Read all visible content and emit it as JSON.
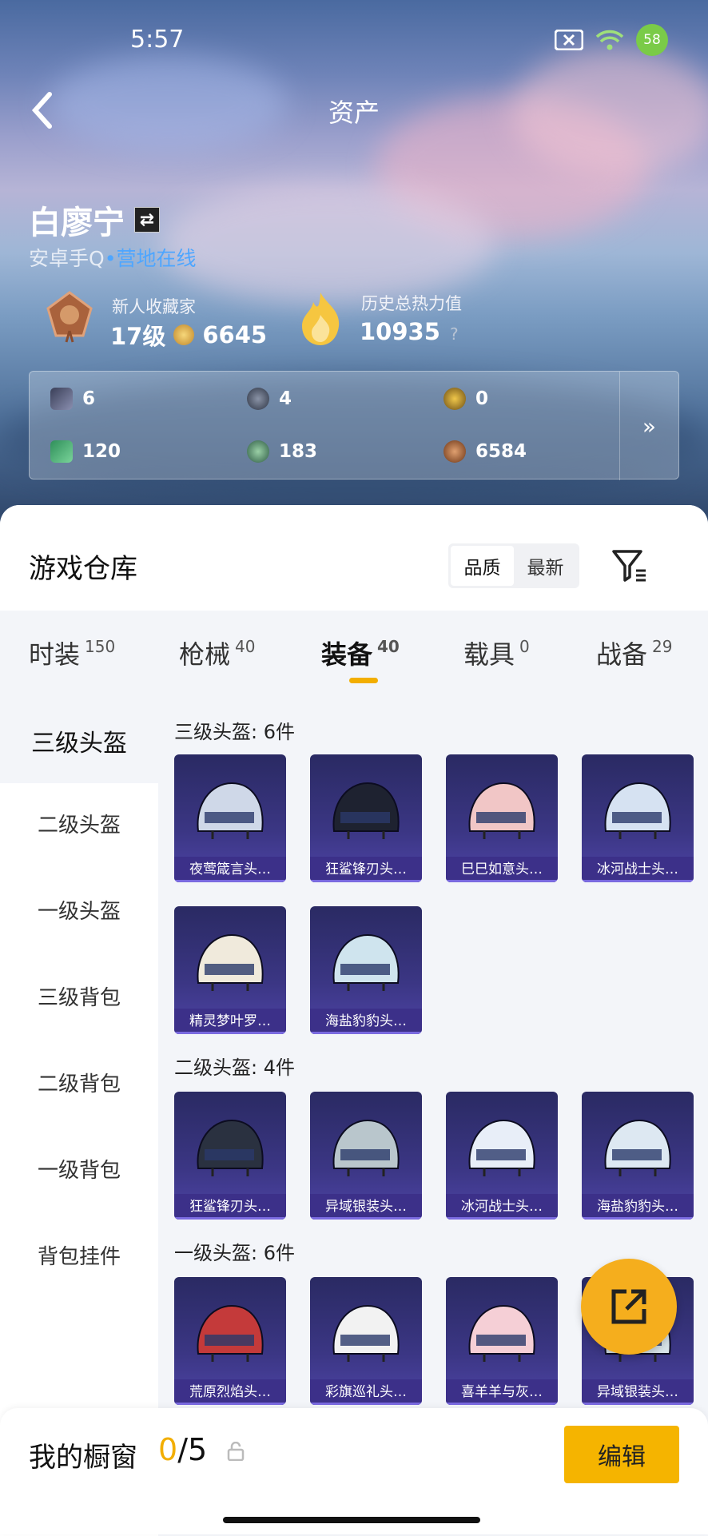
{
  "status": {
    "time": "5:57",
    "battery": "58"
  },
  "header": {
    "title": "资产"
  },
  "user": {
    "name": "白廖宁",
    "platform": "安卓手Q",
    "dot": "•",
    "online": "营地在线"
  },
  "level": {
    "title": "新人收藏家",
    "level": "17级",
    "coins": "6645"
  },
  "heat": {
    "title": "历史总热力值",
    "value": "10935",
    "help": "?"
  },
  "stats": [
    {
      "value": "6",
      "icon": "card-icon"
    },
    {
      "value": "4",
      "icon": "silver-coin-icon"
    },
    {
      "value": "0",
      "icon": "gold-coin-icon"
    },
    {
      "value": "120",
      "icon": "ticket-icon"
    },
    {
      "value": "183",
      "icon": "gem-icon"
    },
    {
      "value": "6584",
      "icon": "bronze-coin-icon"
    }
  ],
  "stats_more": "»",
  "warehouse": {
    "title": "游戏仓库",
    "sort": [
      "品质",
      "最新"
    ]
  },
  "tabs": [
    {
      "label": "时装",
      "count": "150"
    },
    {
      "label": "枪械",
      "count": "40"
    },
    {
      "label": "装备",
      "count": "40"
    },
    {
      "label": "载具",
      "count": "0"
    },
    {
      "label": "战备",
      "count": "29"
    }
  ],
  "sidebar": [
    "三级头盔",
    "二级头盔",
    "一级头盔",
    "三级背包",
    "二级背包",
    "一级背包",
    "背包挂件"
  ],
  "groups": [
    {
      "title": "三级头盔: 6件",
      "items": [
        "夜莺箴言头…",
        "狂鲨锋刃头…",
        "巳巳如意头…",
        "冰河战士头…",
        "精灵梦叶罗…",
        "海盐豹豹头…"
      ]
    },
    {
      "title": "二级头盔: 4件",
      "items": [
        "狂鲨锋刃头…",
        "异域银装头…",
        "冰河战士头…",
        "海盐豹豹头…"
      ]
    },
    {
      "title": "一级头盔: 6件",
      "items": [
        "荒原烈焰头…",
        "彩旗巡礼头…",
        "喜羊羊与灰…",
        "异域银装头…"
      ]
    }
  ],
  "showcase": {
    "title": "我的橱窗",
    "current": "0",
    "total": "/5",
    "edit": "编辑"
  },
  "colors": {
    "accent": "#f5b400",
    "card": "#3b3684",
    "online": "#4ea6ff"
  }
}
